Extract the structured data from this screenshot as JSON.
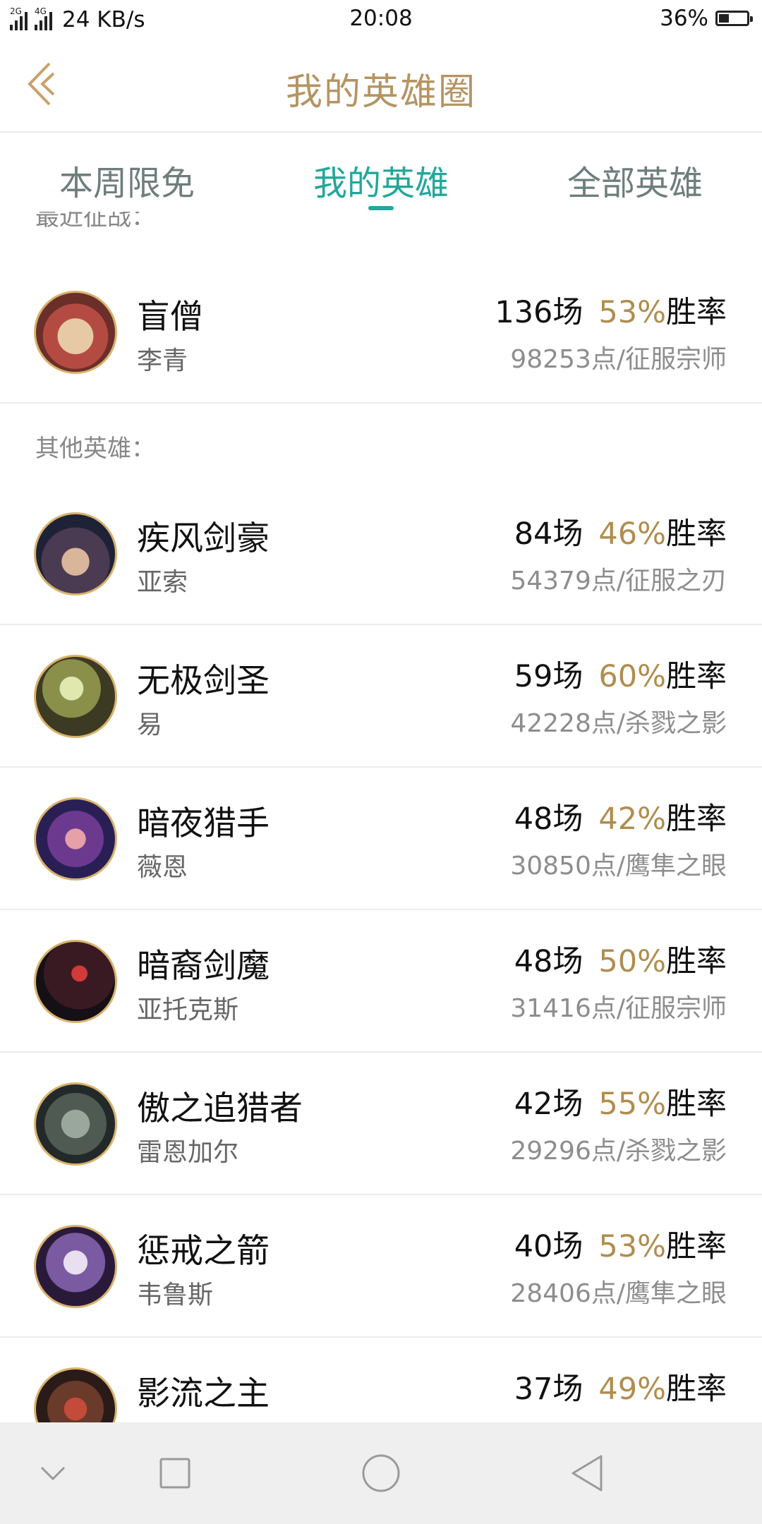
{
  "status": {
    "net_1": "2G",
    "net_2": "4G",
    "speed": "24 KB/s",
    "time": "20:08",
    "battery": "36%",
    "battery_level": 0.36
  },
  "header": {
    "title": "我的英雄圈"
  },
  "tabs": [
    {
      "label": "本周限免",
      "active": false
    },
    {
      "label": "我的英雄",
      "active": true
    },
    {
      "label": "全部英雄",
      "active": false
    }
  ],
  "recent_label": "最近征战：",
  "other_label": "其他英雄：",
  "recent": {
    "name": "盲僧",
    "sub": "李青",
    "games": "136场",
    "pct": "53%",
    "rate": "胜率",
    "points": "98253点/征服宗师"
  },
  "heroes": [
    {
      "name": "疾风剑豪",
      "sub": "亚索",
      "games": "84场",
      "pct": "46%",
      "rate": "胜率",
      "points": "54379点/征服之刃"
    },
    {
      "name": "无极剑圣",
      "sub": "易",
      "games": "59场",
      "pct": "60%",
      "rate": "胜率",
      "points": "42228点/杀戮之影"
    },
    {
      "name": "暗夜猎手",
      "sub": "薇恩",
      "games": "48场",
      "pct": "42%",
      "rate": "胜率",
      "points": "30850点/鹰隼之眼"
    },
    {
      "name": "暗裔剑魔",
      "sub": "亚托克斯",
      "games": "48场",
      "pct": "50%",
      "rate": "胜率",
      "points": "31416点/征服宗师"
    },
    {
      "name": "傲之追猎者",
      "sub": "雷恩加尔",
      "games": "42场",
      "pct": "55%",
      "rate": "胜率",
      "points": "29296点/杀戮之影"
    },
    {
      "name": "惩戒之箭",
      "sub": "韦鲁斯",
      "games": "40场",
      "pct": "53%",
      "rate": "胜率",
      "points": "28406点/鹰隼之眼"
    },
    {
      "name": "影流之主",
      "sub": "",
      "games": "37场",
      "pct": "49%",
      "rate": "胜率",
      "points": ""
    }
  ],
  "colors": {
    "accent": "#23a79a",
    "gold": "#b59463",
    "pct": "#b08d4e"
  },
  "nav": {
    "icons": [
      "chevron-down-icon",
      "square-icon",
      "circle-icon",
      "triangle-back-icon"
    ]
  }
}
